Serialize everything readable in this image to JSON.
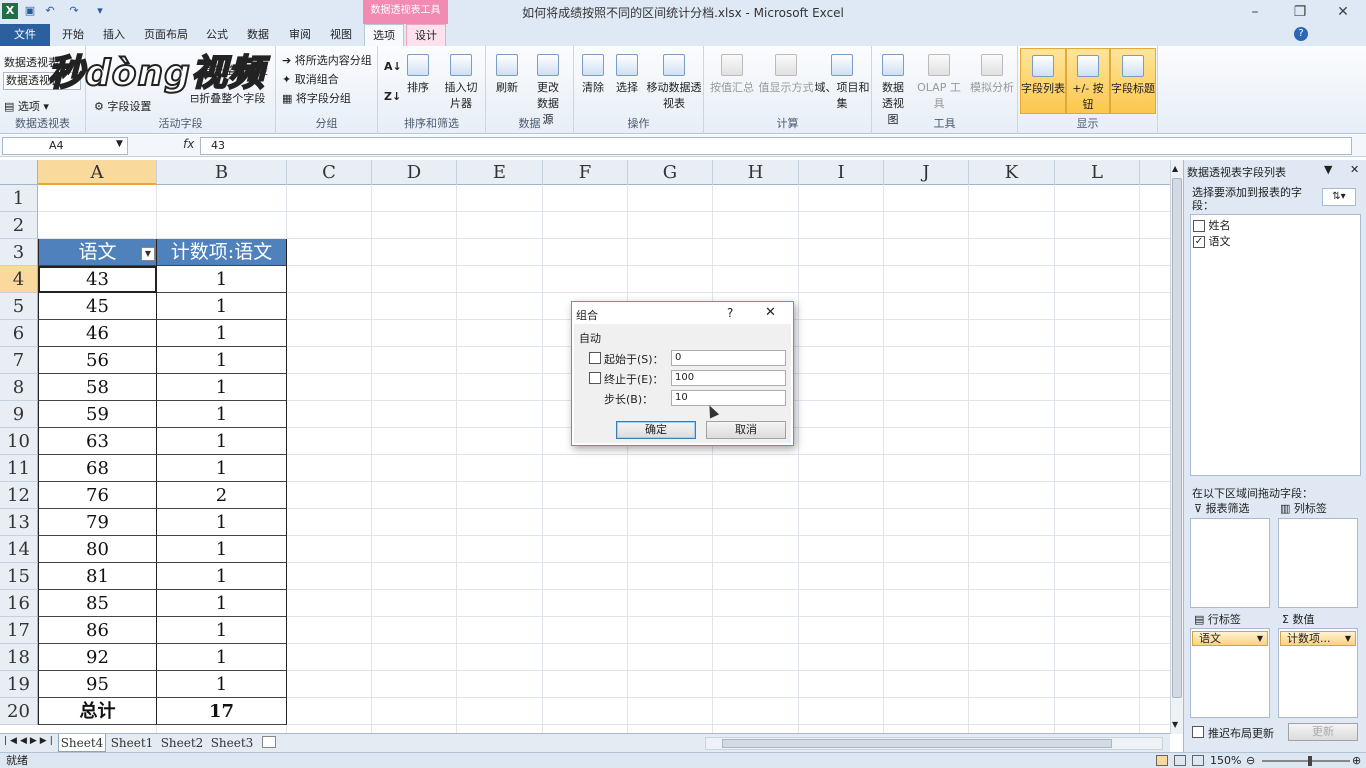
{
  "window": {
    "title": "如何将成绩按照不同的区间统计分档.xlsx - Microsoft Excel",
    "context_tab_header": "数据透视表工具"
  },
  "tabs": [
    "文件",
    "开始",
    "插入",
    "页面布局",
    "公式",
    "数据",
    "审阅",
    "视图",
    "选项",
    "设计"
  ],
  "active_tab": "选项",
  "ribbon": {
    "pivot_group": {
      "name_label": "数据透视表",
      "name_value": "数据透视表",
      "options": "选项",
      "label": "数据透视表"
    },
    "active_field": {
      "field_setting": "字段设置",
      "expand_field": "展开整个字段",
      "collapse_field": "折叠整个字段",
      "label": "活动字段"
    },
    "group": {
      "group_selection": "将所选内容分组",
      "ungroup": "取消组合",
      "group_field": "将字段分组",
      "label": "分组"
    },
    "sort": {
      "sort": "排序",
      "slicer": "插入切片器",
      "label": "排序和筛选"
    },
    "data": {
      "refresh": "刷新",
      "change_source": "更改数据源",
      "label": "数据"
    },
    "actions": {
      "clear": "清除",
      "select": "选择",
      "move": "移动数据透视表",
      "label": "操作"
    },
    "calc": {
      "summarize": "按值汇总",
      "show_as": "值显示方式",
      "fields_items": "域、项目和集",
      "label": "计算"
    },
    "tools": {
      "pivotchart": "数据透视图",
      "olap": "OLAP 工具",
      "whatif": "模拟分析",
      "label": "工具"
    },
    "show": {
      "field_list": "字段列表",
      "buttons": "+/- 按钮",
      "field_headers": "字段标题",
      "label": "显示"
    }
  },
  "watermark": "秒dòng视频",
  "formula_bar": {
    "name_box": "A4",
    "fx": "fx",
    "value": "43"
  },
  "columns": [
    "A",
    "B",
    "C",
    "D",
    "E",
    "F",
    "G",
    "H",
    "I",
    "J",
    "K",
    "L"
  ],
  "rows": [
    "1",
    "2",
    "3",
    "4",
    "5",
    "6",
    "7",
    "8",
    "9",
    "10",
    "11",
    "12",
    "13",
    "14",
    "15",
    "16",
    "17",
    "18",
    "19",
    "20"
  ],
  "pivot": {
    "header_a": "语文",
    "header_b": "计数项:语文",
    "data": [
      [
        "43",
        "1"
      ],
      [
        "45",
        "1"
      ],
      [
        "46",
        "1"
      ],
      [
        "56",
        "1"
      ],
      [
        "58",
        "1"
      ],
      [
        "59",
        "1"
      ],
      [
        "63",
        "1"
      ],
      [
        "68",
        "1"
      ],
      [
        "76",
        "2"
      ],
      [
        "79",
        "1"
      ],
      [
        "80",
        "1"
      ],
      [
        "81",
        "1"
      ],
      [
        "85",
        "1"
      ],
      [
        "86",
        "1"
      ],
      [
        "92",
        "1"
      ],
      [
        "95",
        "1"
      ]
    ],
    "total_label": "总计",
    "total_value": "17"
  },
  "dialog": {
    "title": "组合",
    "help": "?",
    "close": "✕",
    "section": "自动",
    "start_label": "起始于(S)：",
    "start_value": "0",
    "end_label": "终止于(E)：",
    "end_value": "100",
    "step_label": "步长(B)：",
    "step_value": "10",
    "ok": "确定",
    "cancel": "取消"
  },
  "field_list": {
    "title": "数据透视表字段列表",
    "choose_label": "选择要添加到报表的字段：",
    "fields": [
      {
        "name": "姓名",
        "checked": false
      },
      {
        "name": "语文",
        "checked": true
      }
    ],
    "drag_label": "在以下区域间拖动字段：",
    "report_filter": "报表筛选",
    "column_labels": "列标签",
    "row_labels": "行标签",
    "values": "数值",
    "row_field": "语文",
    "value_field": "计数项...",
    "defer_label": "推迟布局更新",
    "update": "更新"
  },
  "sheets": [
    "Sheet4",
    "Sheet1",
    "Sheet2",
    "Sheet3"
  ],
  "status": {
    "mode": "就绪",
    "zoom": "150%"
  }
}
